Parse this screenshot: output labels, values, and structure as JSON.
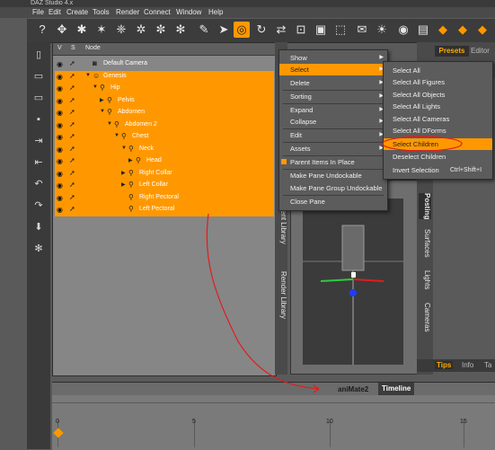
{
  "window": {
    "title": "DAZ Studio 4.x"
  },
  "menubar": [
    "File",
    "Edit",
    "Create",
    "Tools",
    "Render",
    "Connect",
    "Window",
    "Help"
  ],
  "scene": {
    "columns": [
      "V",
      "S",
      "Node"
    ],
    "nodes": [
      {
        "label": "Default Camera",
        "depth": 0,
        "expanded": null,
        "icon": "camera",
        "selected": false
      },
      {
        "label": "Genesis",
        "depth": 0,
        "expanded": true,
        "icon": "figure",
        "selected": true
      },
      {
        "label": "Hip",
        "depth": 1,
        "expanded": true,
        "icon": "bone",
        "selected": true
      },
      {
        "label": "Pelvis",
        "depth": 2,
        "expanded": false,
        "icon": "bone",
        "selected": true
      },
      {
        "label": "Abdomen",
        "depth": 2,
        "expanded": true,
        "icon": "bone",
        "selected": true
      },
      {
        "label": "Abdomen 2",
        "depth": 3,
        "expanded": true,
        "icon": "bone",
        "selected": true
      },
      {
        "label": "Chest",
        "depth": 4,
        "expanded": true,
        "icon": "bone",
        "selected": true
      },
      {
        "label": "Neck",
        "depth": 5,
        "expanded": true,
        "icon": "bone",
        "selected": true
      },
      {
        "label": "Head",
        "depth": 6,
        "expanded": false,
        "icon": "bone",
        "selected": true
      },
      {
        "label": "Right Collar",
        "depth": 5,
        "expanded": false,
        "icon": "bone",
        "selected": true
      },
      {
        "label": "Left Collar",
        "depth": 5,
        "expanded": false,
        "icon": "bone",
        "selected": true
      },
      {
        "label": "Right Pectoral",
        "depth": 5,
        "expanded": null,
        "icon": "bone",
        "selected": true
      },
      {
        "label": "Left Pectoral",
        "depth": 5,
        "expanded": null,
        "icon": "bone",
        "selected": true
      }
    ]
  },
  "context_menu": {
    "items": [
      "Show",
      "Select",
      "Delete",
      "Sorting",
      "Expand",
      "Collapse",
      "Edit",
      "Assets",
      "Parent Items In Place",
      "Make Pane Undockable",
      "Make Pane Group Undockable",
      "Close Pane"
    ],
    "highlighted": "Select",
    "checked": "Parent Items In Place"
  },
  "submenu": {
    "items": [
      {
        "label": "Select All",
        "shortcut": ""
      },
      {
        "label": "Select All Figures",
        "shortcut": ""
      },
      {
        "label": "Select All Objects",
        "shortcut": ""
      },
      {
        "label": "Select All Lights",
        "shortcut": ""
      },
      {
        "label": "Select All Cameras",
        "shortcut": ""
      },
      {
        "label": "Select All DForms",
        "shortcut": ""
      },
      {
        "label": "Select Children",
        "shortcut": ""
      },
      {
        "label": "Deselect Children",
        "shortcut": ""
      },
      {
        "label": "Invert Selection",
        "shortcut": "Ctrl+Shift+I"
      }
    ],
    "highlighted": "Select Children"
  },
  "side_tabs": {
    "content_library": "Content Library",
    "render_library": "Render Library"
  },
  "right_panel": {
    "tabs": [
      "Presets",
      "Editor"
    ],
    "vertical_tabs": [
      "Posting",
      "Surfaces",
      "Lights",
      "Cameras"
    ],
    "bottom_tabs": [
      "Tips",
      "Info",
      "Ta"
    ]
  },
  "timeline": {
    "tabs": [
      "aniMate2",
      "Timeline"
    ],
    "active_tab": "Timeline",
    "ticks": [
      0,
      5,
      10,
      15
    ]
  },
  "colors": {
    "accent": "#ff9800",
    "annotation": "#e21c1c"
  }
}
